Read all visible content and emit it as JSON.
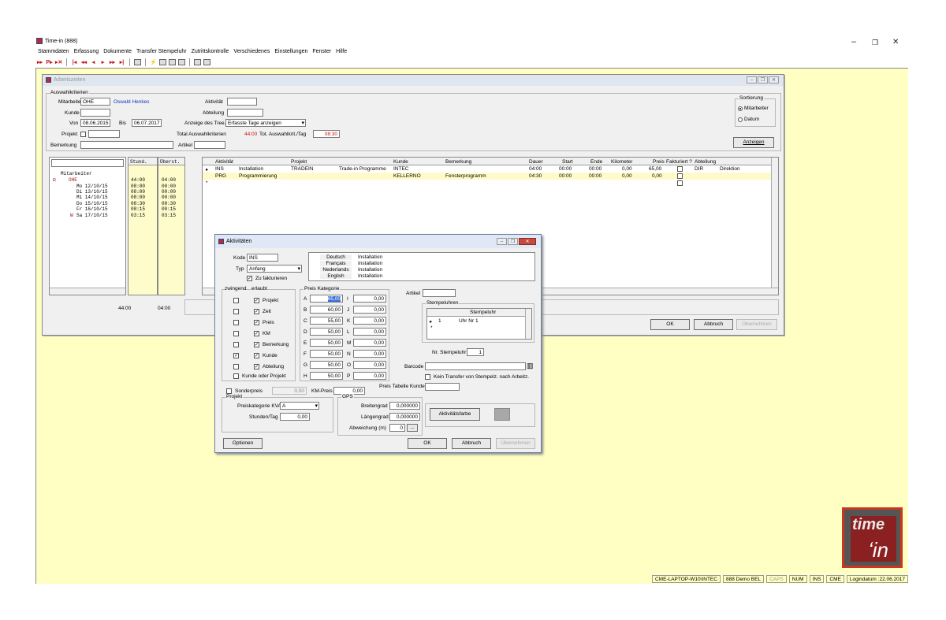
{
  "app": {
    "title": "Time-in (888)",
    "controls": [
      "–",
      "❐",
      "✕"
    ]
  },
  "menu": [
    "Stammdaten",
    "Erfassung",
    "Dokumente",
    "Transfer Stempeluhr",
    "Zutrittskontrolle",
    "Verschiedenes",
    "Einstellungen",
    "Fenster",
    "Hilfe"
  ],
  "arbeitszeiten": {
    "title": "Arbeitszeiten",
    "auswahl_legend": "Auswahlkriterien",
    "mitarbeiter_label": "Mitarbeiter",
    "mitarbeiter": "OHE",
    "mitarbeiter_name": "Oswald Henkes",
    "kunde_label": "Kunde",
    "von_label": "Von",
    "von": "08.06.2015",
    "bis_label": "Bis",
    "bis": "06.07.2017",
    "projekt_label": "Projekt",
    "bemerkung_label": "Bemerkung",
    "aktivitaet_label": "Aktivität",
    "abteilung_label": "Abteilung",
    "anzeige_label": "Anzeige des Tree.",
    "anzeige": "Erfasste Tage anzeigen",
    "total_label": "Total Auswahlkriterien",
    "total": "44:00",
    "tot_tag_label": "Tot. Auswahlkrit./Tag",
    "tot_tag": "08:30",
    "artikel_label": "Artikel",
    "sortierung_legend": "Sortierung",
    "sort_mitarbeiter": "Mitarbeiter",
    "sort_datum": "Datum",
    "anzeigen_btn": "Anzeigen",
    "tree": {
      "col_stund": "Stund.",
      "col_uberst": "Überst.",
      "root": "Mitarbeiter",
      "emp": "OHE",
      "rows": [
        {
          "day": "Mo 12/10/15",
          "h": "08:00",
          "o": "00:00"
        },
        {
          "day": "Di 13/10/15",
          "h": "08:00",
          "o": "00:00"
        },
        {
          "day": "Mi 14/10/15",
          "h": "08:00",
          "o": "00:00"
        },
        {
          "day": "Do 15/10/15",
          "h": "08:30",
          "o": "00:30"
        },
        {
          "day": "Fr 16/10/15",
          "h": "08:15",
          "o": "00:15"
        },
        {
          "day": "Sa 17/10/15",
          "h": "03:15",
          "o": "03:15"
        }
      ],
      "emp_h": "44:00",
      "emp_o": "04:00",
      "w_mark": "W"
    },
    "grid": {
      "headers": [
        "Aktivität",
        "Projekt",
        "Kunde",
        "Bemerkung",
        "Dauer",
        "Start",
        "Ende",
        "Kilometer",
        "Preis",
        "Fakturiert ?",
        "Abteilung"
      ],
      "rows": [
        {
          "code": "INS",
          "name": "Installation",
          "proj": "TRADEIN",
          "projname": "Trade-in Programme",
          "kunde": "INTEC",
          "bem": "",
          "dauer": "04:00",
          "start": "00:00",
          "ende": "00:00",
          "km": "0,00",
          "preis": "65,00",
          "abt": "DIR",
          "abtname": "Direktion"
        },
        {
          "code": "PRG",
          "name": "Programmierung",
          "proj": "",
          "projname": "",
          "kunde": "KELLERNO",
          "bem": "Fensterprogramm",
          "dauer": "04:30",
          "start": "00:00",
          "ende": "00:00",
          "km": "0,00",
          "preis": "0,00",
          "abt": "",
          "abtname": ""
        }
      ]
    },
    "sum_h": "44:00",
    "sum_o": "04:00",
    "ok": "OK",
    "abbruch": "Abbruch",
    "ubernehmen": "Übernehmen"
  },
  "aktivitaeten": {
    "title": "Aktivitäten",
    "kode_label": "Kode",
    "kode": "INS",
    "typ_label": "Typ",
    "typ": "Anfang",
    "zu_fakturieren": "Zu fakturieren",
    "langs": [
      {
        "l": "Deutsch",
        "v": "Installation"
      },
      {
        "l": "Français",
        "v": "Installation"
      },
      {
        "l": "Nederlands",
        "v": "Installation"
      },
      {
        "l": "English",
        "v": "Installation"
      }
    ],
    "zwingend": "zwingend",
    "erlaubt": "erlaubt",
    "checks": [
      {
        "label": "Projekt",
        "z": false,
        "e": true
      },
      {
        "label": "Zeit",
        "z": false,
        "e": true
      },
      {
        "label": "Preis",
        "z": false,
        "e": true
      },
      {
        "label": "KM",
        "z": false,
        "e": true
      },
      {
        "label": "Bemerkung",
        "z": false,
        "e": true
      },
      {
        "label": "Kunde",
        "z": true,
        "e": true
      },
      {
        "label": "Abteilung",
        "z": false,
        "e": true
      }
    ],
    "kunde_oder_projekt": "Kunde oder Projekt",
    "preis_kat_legend": "Preis Kategorie",
    "preise_left": [
      {
        "k": "A",
        "v": "65,00"
      },
      {
        "k": "B",
        "v": "60,00"
      },
      {
        "k": "C",
        "v": "55,00"
      },
      {
        "k": "D",
        "v": "50,00"
      },
      {
        "k": "E",
        "v": "50,00"
      },
      {
        "k": "F",
        "v": "50,00"
      },
      {
        "k": "G",
        "v": "50,00"
      },
      {
        "k": "H",
        "v": "50,00"
      }
    ],
    "preise_right": [
      {
        "k": "I",
        "v": "0,00"
      },
      {
        "k": "J",
        "v": "0,00"
      },
      {
        "k": "K",
        "v": "0,00"
      },
      {
        "k": "L",
        "v": "0,00"
      },
      {
        "k": "M",
        "v": "0,00"
      },
      {
        "k": "N",
        "v": "0,00"
      },
      {
        "k": "O",
        "v": "0,00"
      },
      {
        "k": "P",
        "v": "0,00"
      }
    ],
    "artikel_label": "Artikel",
    "stempeluhren_legend": "Stempeluhren",
    "stempeluhr_col": "Stempeluhr",
    "uhr_nr": "1",
    "uhr_name": "Uhr Nr 1",
    "nr_stempeluhr_label": "Nr. Stempeluhr",
    "nr_stempeluhr": "1",
    "barcode_label": "Barcode",
    "kein_transfer": "Kein Transfer von Stempelz. nach Arbeitz.",
    "sonderpreis": "Sonderpreis",
    "sonderpreis_val": "0,00",
    "km_preis_label": "KM-Preis",
    "km_preis": "0,00",
    "preis_tabelle": "Preis Tabelle Kunde",
    "projekt_legend": "Projekt",
    "preiskat_kva_label": "Preiskategorie KVA",
    "preiskat_kva": "A",
    "stunden_tag_label": "Stunden/Tag",
    "stunden_tag": "0,00",
    "gps_legend": "GPS",
    "breitengrad_label": "Breitengrad",
    "breitengrad": "0,000000",
    "laengengrad_label": "Längengrad",
    "laengengrad": "0,000000",
    "abweichung_label": "Abweichung (m)",
    "abweichung": "0",
    "aktivitaetsfarbe": "Aktivitätsfarbe",
    "farbe": "#a8a8a8",
    "optionen": "Optionen",
    "ok": "OK",
    "abbruch": "Abbruch",
    "ubernehmen": "Übernehmen"
  },
  "status": [
    "CME-LAPTOP-W10\\INTEC",
    "888 Demo BEL",
    "CAPS",
    "NUM",
    "INS",
    "CME",
    "Logindatum :22.06.2017"
  ],
  "logo_text": "time"
}
